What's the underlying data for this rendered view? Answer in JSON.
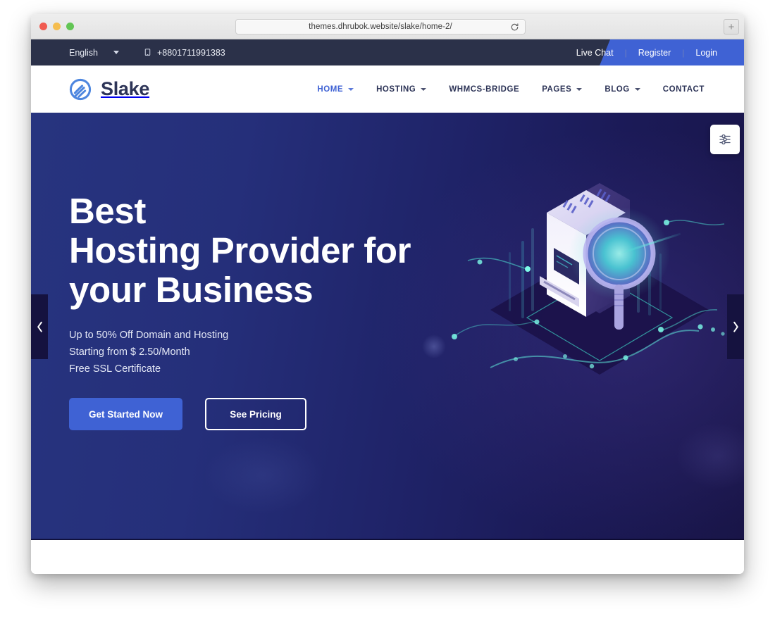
{
  "browser": {
    "url": "themes.dhrubok.website/slake/home-2/",
    "reload_icon": "reload-icon",
    "new_tab_label": "+",
    "traffic_lights": [
      "close",
      "minimize",
      "zoom"
    ]
  },
  "topbar": {
    "language": "English",
    "language_caret": "chevron-down-icon",
    "phone_icon": "phone-icon",
    "phone": "+8801711991383",
    "links": [
      {
        "label": "Live Chat"
      },
      {
        "label": "Register"
      },
      {
        "label": "Login"
      }
    ],
    "separator": "|",
    "bg": "#2b3149",
    "accent": "#3f62d4"
  },
  "header": {
    "logo_text": "Slake",
    "logo_icon": "slake-swirl-logo",
    "nav": [
      {
        "label": "HOME",
        "active": true,
        "has_dropdown": true
      },
      {
        "label": "HOSTING",
        "active": false,
        "has_dropdown": true
      },
      {
        "label": "WHMCS-BRIDGE",
        "active": false,
        "has_dropdown": false
      },
      {
        "label": "PAGES",
        "active": false,
        "has_dropdown": true
      },
      {
        "label": "BLOG",
        "active": false,
        "has_dropdown": true
      },
      {
        "label": "CONTACT",
        "active": false,
        "has_dropdown": false
      }
    ],
    "active_color": "#3f62d4",
    "text_color": "#2d3457"
  },
  "hero": {
    "title_line_1": "Best",
    "title_line_2": "Hosting Provider for",
    "title_line_3": "your Business",
    "bullets": [
      "Up to 50% Off Domain and Hosting",
      "Starting from $ 2.50/Month",
      "Free SSL Certificate"
    ],
    "primary_button": "Get Started Now",
    "secondary_button": "See Pricing",
    "prev_arrow": "chevron-left-icon",
    "next_arrow": "chevron-right-icon",
    "settings_icon": "sliders-icon",
    "illustration": "isometric-server-magnifier",
    "bg_start": "#27347f",
    "bg_end": "#191548"
  }
}
